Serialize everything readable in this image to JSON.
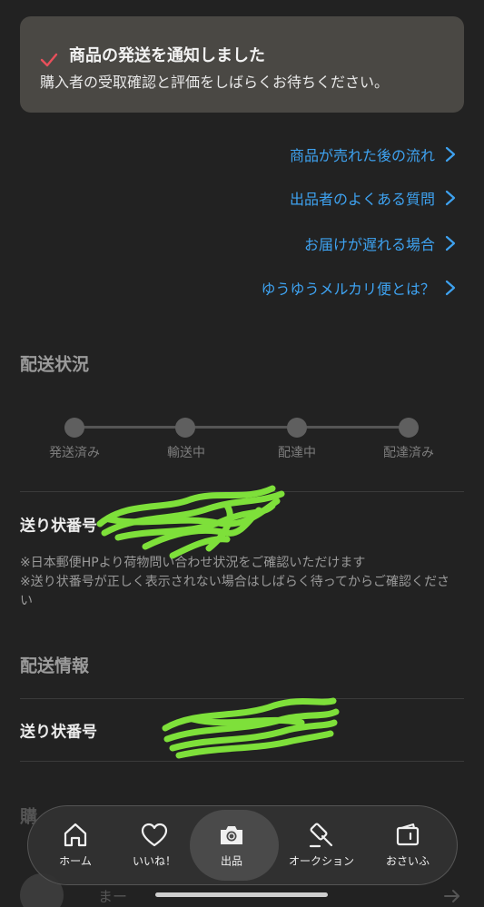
{
  "notice": {
    "title": "商品の発送を通知しました",
    "message": "購入者の受取確認と評価をしばらくお待ちください。"
  },
  "help_links": [
    {
      "label": "商品が売れた後の流れ"
    },
    {
      "label": "出品者のよくある質問"
    },
    {
      "label": "お届けが遅れる場合"
    },
    {
      "label": "ゆうゆうメルカリ便とは？"
    }
  ],
  "shipping_status": {
    "heading": "配送状況",
    "steps": [
      "発送済み",
      "輸送中",
      "配達中",
      "配達済み"
    ]
  },
  "tracking": {
    "label": "送り状番号",
    "note_1": "※日本郵便HPより荷物問い合わせ状況をご確認いただけます",
    "note_2": "※送り状番号が正しく表示されない場合はしばらく待ってからご確認ください"
  },
  "shipping_info": {
    "heading": "配送情報",
    "tracking_label": "送り状番号"
  },
  "faded": {
    "heading": "購",
    "name": "まー"
  },
  "nav": [
    {
      "label": "ホーム",
      "icon": "home-icon"
    },
    {
      "label": "いいね！",
      "icon": "heart-icon"
    },
    {
      "label": "出品",
      "icon": "camera-icon"
    },
    {
      "label": "オークション",
      "icon": "gavel-icon"
    },
    {
      "label": "おさいふ",
      "icon": "wallet-icon"
    }
  ],
  "colors": {
    "background": "#222222",
    "link": "#3ea2f0",
    "check": "#e8505b",
    "redaction": "#7ee03a"
  }
}
